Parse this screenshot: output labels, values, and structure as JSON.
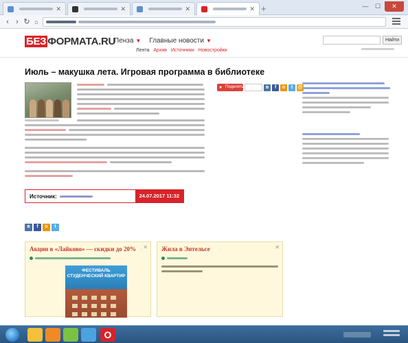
{
  "browser": {
    "tabs": [
      {
        "title": "",
        "favicon_color": "#5b8fd1",
        "active": false
      },
      {
        "title": "",
        "favicon_color": "#333333",
        "active": false
      },
      {
        "title": "",
        "favicon_color": "#5b8fd1",
        "active": false
      },
      {
        "title": "",
        "favicon_color": "#d8232a",
        "active": true
      }
    ],
    "new_tab_symbol": "+",
    "address": ""
  },
  "header": {
    "logo_red": "БЕЗ",
    "logo_dark": "ФОРМАТА.RU",
    "city_nav": [
      {
        "label": "Пенза"
      },
      {
        "label": "Главные новости"
      }
    ],
    "subnav": [
      "Лента",
      "Архив",
      "Источники",
      "Новостройки"
    ],
    "search_placeholder": "",
    "search_button": "Найти"
  },
  "article": {
    "title": "Июль – макушка лета. Игровая программа в библиотеке",
    "share_label": "Поделиться",
    "source": {
      "label": "Источник:",
      "name": "",
      "datetime": "24.07.2017  11:32"
    }
  },
  "ads": [
    {
      "title": "Акции в «Лайково» — скидки до 20%",
      "url": "",
      "image_text": "ФЕСТИВАЛЬ СТУДЕНЧЕСКИЙ КВАРТИР"
    },
    {
      "title": "Жила в Энтельсе",
      "url": "",
      "text": ""
    }
  ],
  "colors": {
    "brand_red": "#d8232a",
    "link_blue": "#2b5fb4",
    "ad_background": "#fff8dc",
    "taskbar": "#2b5580"
  }
}
